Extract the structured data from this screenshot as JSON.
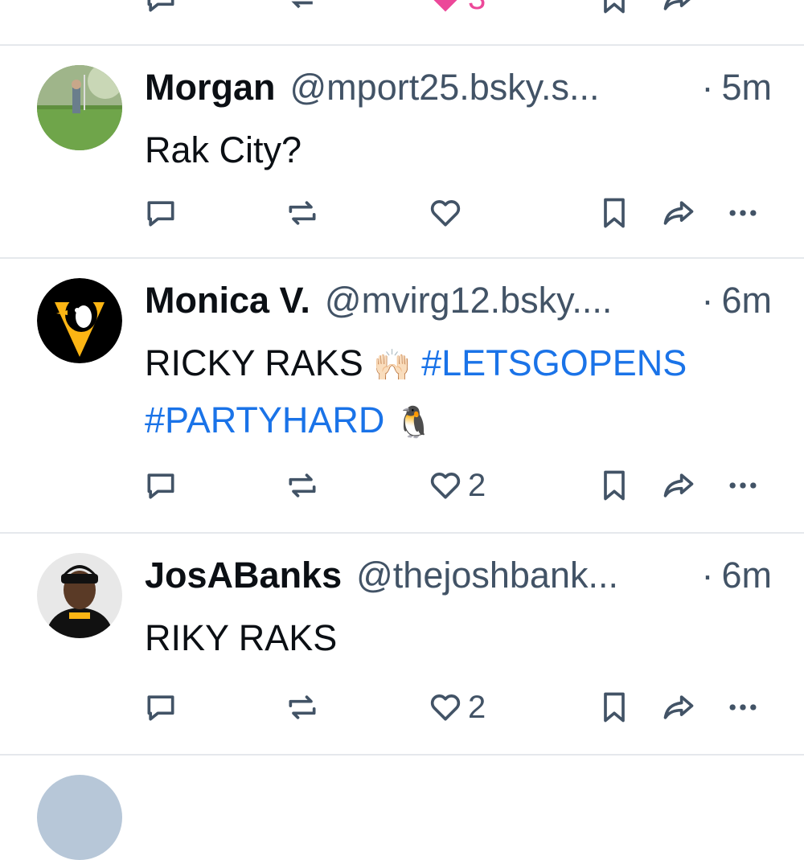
{
  "posts": [
    {
      "name": "Morgan",
      "handle": "@mport25.bsky.s...",
      "dot": "·",
      "time": "5m",
      "text_plain": "Rak City?",
      "like_count": ""
    },
    {
      "name": "Monica V.",
      "handle": "@mvirg12.bsky....",
      "dot": "·",
      "time": "6m",
      "text_plain": "RICKY RAKS",
      "emoji_hands": "🙌🏻",
      "tag1": "#LETSGOPENS",
      "tag2": "#PARTYHARD",
      "emoji_penguin": "🐧",
      "like_count": "2"
    },
    {
      "name": "JosABanks",
      "handle": "@thejoshbank...",
      "dot": "·",
      "time": "6m",
      "text_plain": "RIKY RAKS",
      "like_count": "2"
    }
  ],
  "top_partial_like_count": "3",
  "colors": {
    "icon": "#425366",
    "accent_like": "#ec4899",
    "hashtag": "#1a73e8",
    "divider": "#e5e8ec"
  }
}
